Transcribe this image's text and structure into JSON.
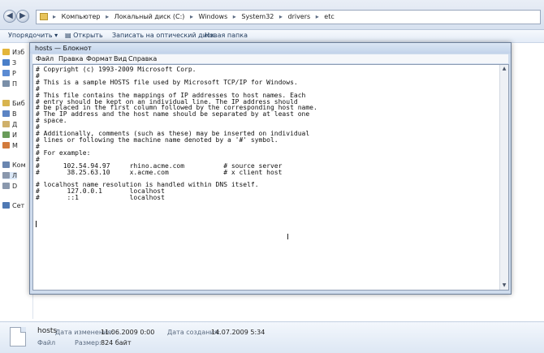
{
  "explorer": {
    "address_path": [
      "Компьютер",
      "Локальный диск (C:)",
      "Windows",
      "System32",
      "drivers",
      "etc"
    ],
    "toolbar": {
      "organize": "Упорядочить ▾",
      "open": "Открыть",
      "burn": "Записать на оптический диск",
      "new_folder": "Новая папка"
    },
    "sidebar": [
      {
        "label": "Изб",
        "icon": "star-icon",
        "color": "#e3b53a"
      },
      {
        "label": "З",
        "icon": "download-icon",
        "color": "#4a7fc9"
      },
      {
        "label": "Р",
        "icon": "desktop-icon",
        "color": "#5b8bd3"
      },
      {
        "label": "П",
        "icon": "places-icon",
        "color": "#7a8fa8"
      },
      {
        "label": "Биб",
        "icon": "library-icon",
        "color": "#d8b44e"
      },
      {
        "label": "В",
        "icon": "video-icon",
        "color": "#5c84c4"
      },
      {
        "label": "Д",
        "icon": "documents-icon",
        "color": "#cfb06a"
      },
      {
        "label": "И",
        "icon": "pictures-icon",
        "color": "#6a9c5a"
      },
      {
        "label": "М",
        "icon": "music-icon",
        "color": "#d27b3c"
      },
      {
        "label": "Ком",
        "icon": "computer-icon",
        "color": "#6a86b0"
      },
      {
        "label": "Л",
        "icon": "drive-icon",
        "color": "#8a98ad"
      },
      {
        "label": "D",
        "icon": "drive-icon",
        "color": "#8a98ad"
      },
      {
        "label": "Сет",
        "icon": "network-icon",
        "color": "#4f79b4"
      }
    ],
    "details": {
      "file_name": "hosts",
      "file_type": "Файл",
      "modified_label": "Дата изменения:",
      "modified_value": "11.06.2009 0:00",
      "size_label": "Размер:",
      "size_value": "824 байт",
      "created_label": "Дата создания:",
      "created_value": "14.07.2009 5:34"
    }
  },
  "notepad": {
    "title": "hosts — Блокнот",
    "menu": [
      "Файл",
      "Правка",
      "Формат",
      "Вид",
      "Справка"
    ],
    "content": "# Copyright (c) 1993-2009 Microsoft Corp.\n#\n# This is a sample HOSTS file used by Microsoft TCP/IP for Windows.\n#\n# This file contains the mappings of IP addresses to host names. Each\n# entry should be kept on an individual line. The IP address should\n# be placed in the first column followed by the corresponding host name.\n# The IP address and the host name should be separated by at least one\n# space.\n#\n# Additionally, comments (such as these) may be inserted on individual\n# lines or following the machine name denoted by a '#' symbol.\n#\n# For example:\n#\n#      102.54.94.97     rhino.acme.com          # source server\n#       38.25.63.10     x.acme.com              # x client host\n\n# localhost name resolution is handled within DNS itself.\n#\t127.0.0.1       localhost\n#\t::1             localhost\n"
  }
}
